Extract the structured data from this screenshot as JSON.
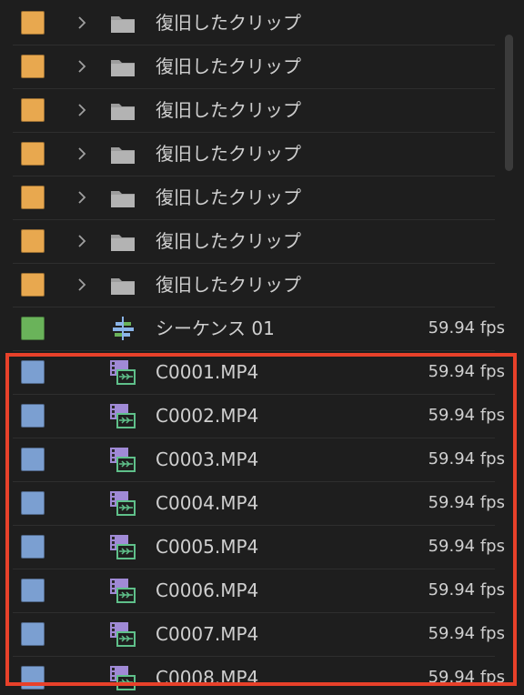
{
  "project_panel": {
    "rows": [
      {
        "kind": "bin",
        "label": "復旧したクリップ",
        "color": "#e8a84f",
        "icon": "folder-icon",
        "fps": ""
      },
      {
        "kind": "bin",
        "label": "復旧したクリップ",
        "color": "#e8a84f",
        "icon": "folder-icon",
        "fps": ""
      },
      {
        "kind": "bin",
        "label": "復旧したクリップ",
        "color": "#e8a84f",
        "icon": "folder-icon",
        "fps": ""
      },
      {
        "kind": "bin",
        "label": "復旧したクリップ",
        "color": "#e8a84f",
        "icon": "folder-icon",
        "fps": ""
      },
      {
        "kind": "bin",
        "label": "復旧したクリップ",
        "color": "#e8a84f",
        "icon": "folder-icon",
        "fps": ""
      },
      {
        "kind": "bin",
        "label": "復旧したクリップ",
        "color": "#e8a84f",
        "icon": "folder-icon",
        "fps": ""
      },
      {
        "kind": "bin",
        "label": "復旧したクリップ",
        "color": "#e8a84f",
        "icon": "folder-icon",
        "fps": ""
      },
      {
        "kind": "sequence",
        "label": "シーケンス 01",
        "color": "#6ab35a",
        "icon": "sequence-icon",
        "fps": "59.94 fps"
      },
      {
        "kind": "clip",
        "label": "C0001.MP4",
        "color": "#7b9fd1",
        "icon": "video-clip-icon",
        "fps": "59.94 fps"
      },
      {
        "kind": "clip",
        "label": "C0002.MP4",
        "color": "#7b9fd1",
        "icon": "video-clip-icon",
        "fps": "59.94 fps"
      },
      {
        "kind": "clip",
        "label": "C0003.MP4",
        "color": "#7b9fd1",
        "icon": "video-clip-icon",
        "fps": "59.94 fps"
      },
      {
        "kind": "clip",
        "label": "C0004.MP4",
        "color": "#7b9fd1",
        "icon": "video-clip-icon",
        "fps": "59.94 fps"
      },
      {
        "kind": "clip",
        "label": "C0005.MP4",
        "color": "#7b9fd1",
        "icon": "video-clip-icon",
        "fps": "59.94 fps"
      },
      {
        "kind": "clip",
        "label": "C0006.MP4",
        "color": "#7b9fd1",
        "icon": "video-clip-icon",
        "fps": "59.94 fps"
      },
      {
        "kind": "clip",
        "label": "C0007.MP4",
        "color": "#7b9fd1",
        "icon": "video-clip-icon",
        "fps": "59.94 fps"
      },
      {
        "kind": "clip",
        "label": "C0008.MP4",
        "color": "#7b9fd1",
        "icon": "video-clip-icon",
        "fps": "59.94 fps"
      }
    ],
    "highlight_color": "#e8412a"
  }
}
